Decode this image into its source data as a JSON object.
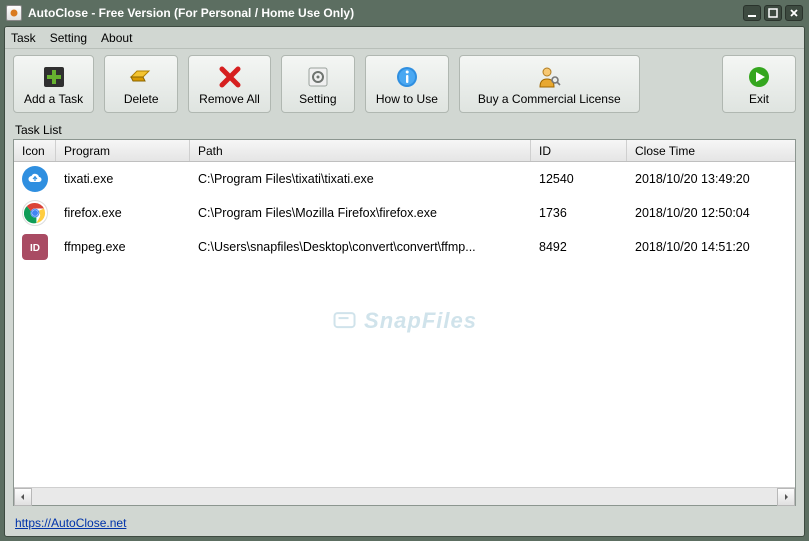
{
  "window": {
    "title": "AutoClose - Free Version (For Personal / Home Use Only)"
  },
  "menu": {
    "task": "Task",
    "setting": "Setting",
    "about": "About"
  },
  "toolbar": {
    "add": "Add a Task",
    "delete": "Delete",
    "remove_all": "Remove All",
    "setting": "Setting",
    "how": "How to Use",
    "buy": "Buy a Commercial License",
    "exit": "Exit"
  },
  "list_label": "Task List",
  "columns": {
    "icon": "Icon",
    "program": "Program",
    "path": "Path",
    "id": "ID",
    "close_time": "Close Time"
  },
  "rows": [
    {
      "program": "tixati.exe",
      "path": "C:\\Program Files\\tixati\\tixati.exe",
      "id": "12540",
      "close_time": "2018/10/20 13:49:20",
      "icon": "cloud"
    },
    {
      "program": "firefox.exe",
      "path": "C:\\Program Files\\Mozilla Firefox\\firefox.exe",
      "id": "1736",
      "close_time": "2018/10/20 12:50:04",
      "icon": "chrome"
    },
    {
      "program": "ffmpeg.exe",
      "path": "C:\\Users\\snapfiles\\Desktop\\convert\\convert\\ffmp...",
      "id": "8492",
      "close_time": "2018/10/20 14:51:20",
      "icon": "id"
    }
  ],
  "watermark": "SnapFiles",
  "footer": {
    "url_label": "https://AutoClose.net"
  }
}
